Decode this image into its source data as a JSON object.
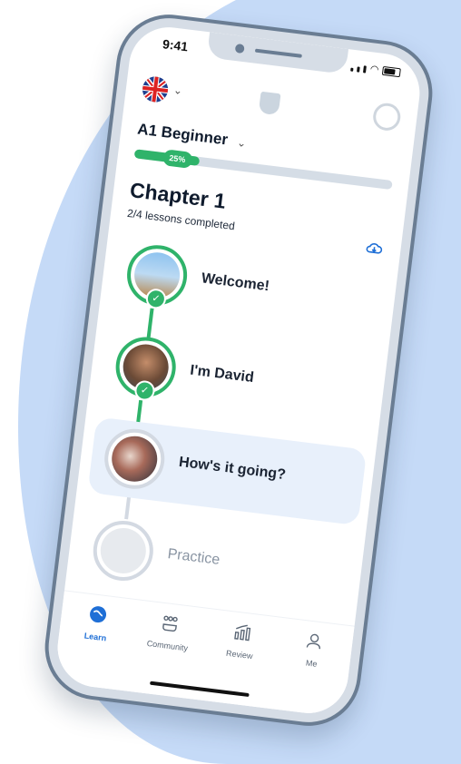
{
  "status": {
    "time": "9:41"
  },
  "level": {
    "label": "A1 Beginner",
    "progress_pct": 25,
    "progress_label": "25%"
  },
  "chapter": {
    "title": "Chapter 1",
    "subtitle": "2/4 lessons completed"
  },
  "lessons": [
    {
      "title": "Welcome!",
      "state": "completed"
    },
    {
      "title": "I'm David",
      "state": "completed"
    },
    {
      "title": "How's it going?",
      "state": "current"
    },
    {
      "title": "Practice",
      "state": "locked"
    }
  ],
  "tabs": [
    {
      "label": "Learn",
      "icon": "globe-icon",
      "active": true
    },
    {
      "label": "Community",
      "icon": "community-icon",
      "active": false
    },
    {
      "label": "Review",
      "icon": "chart-icon",
      "active": false
    },
    {
      "label": "Me",
      "icon": "user-icon",
      "active": false
    }
  ],
  "colors": {
    "accent_green": "#2fb36a",
    "active_blue": "#1f6fd6",
    "background_blue": "#c5daf7"
  }
}
